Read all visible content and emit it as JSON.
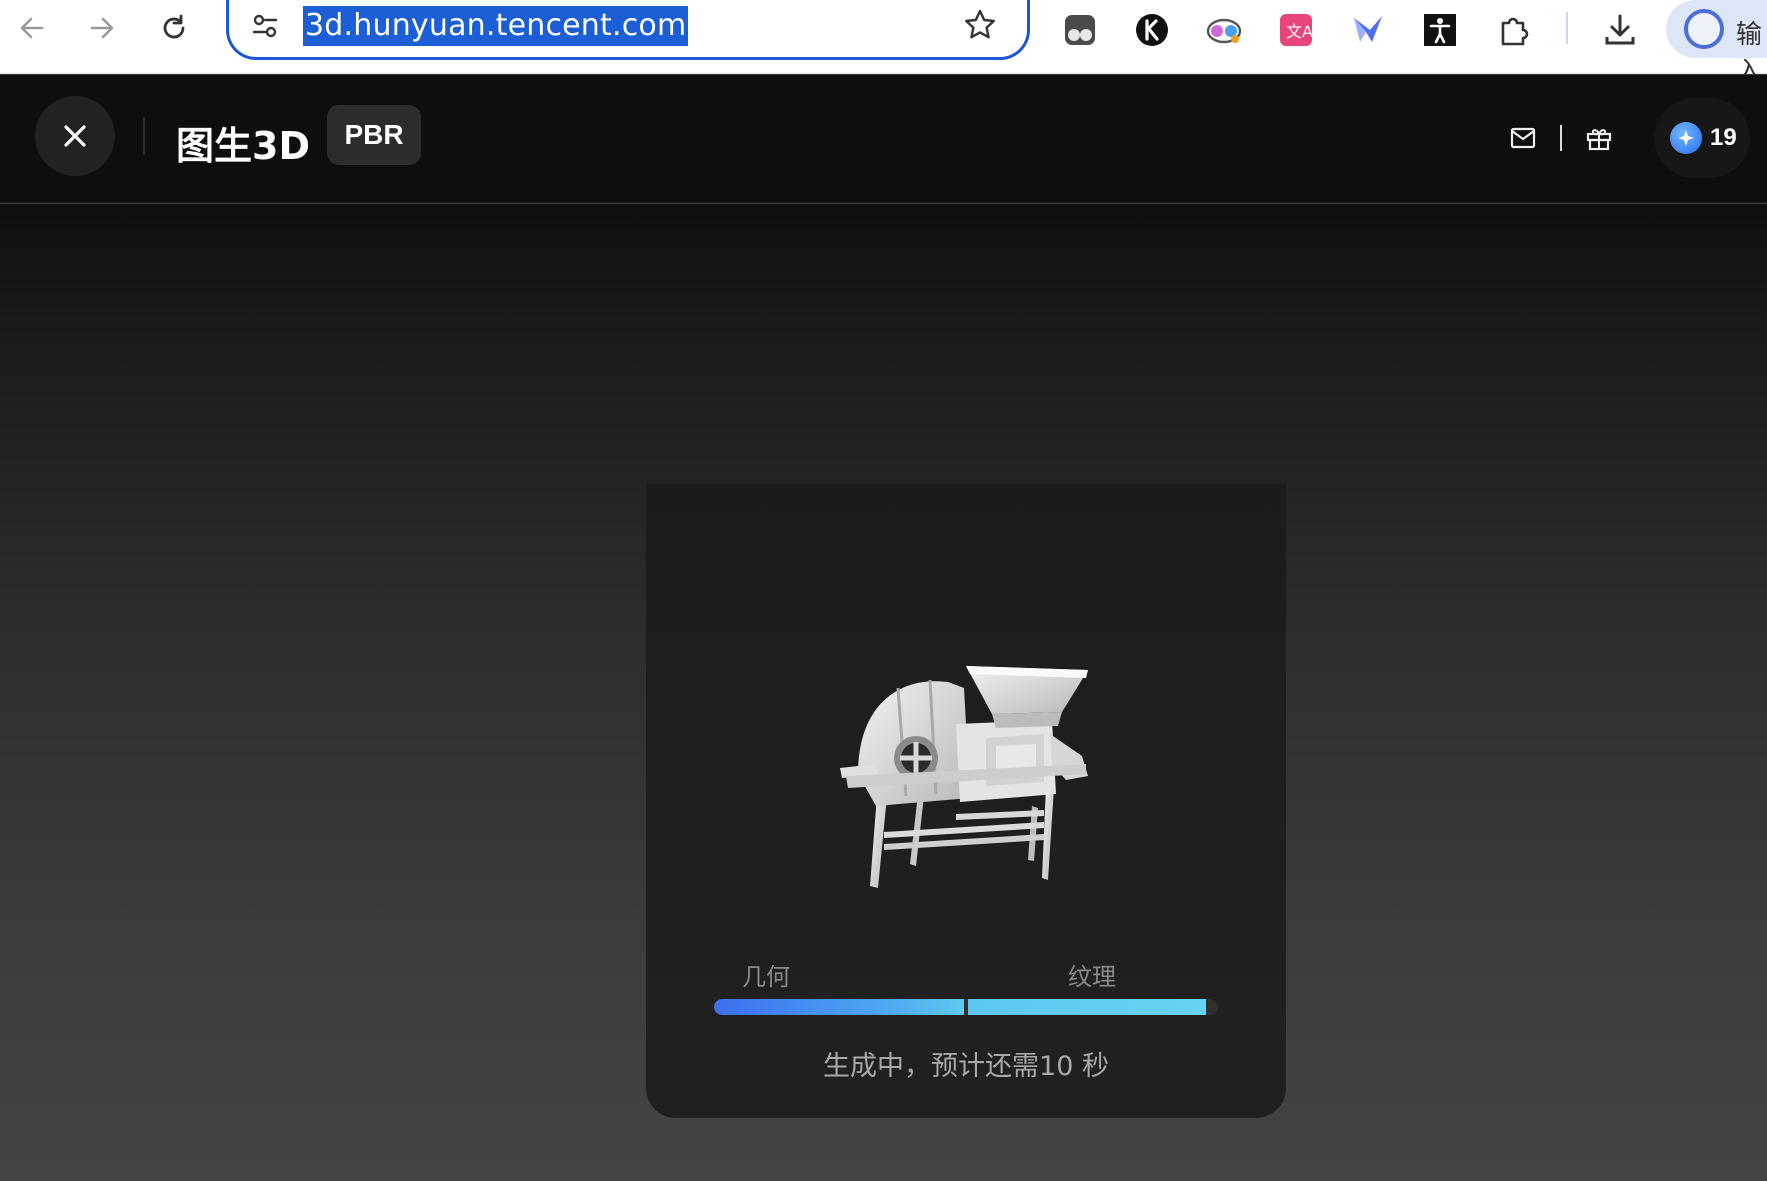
{
  "browser": {
    "url": "3d.hunyuan.tencent.com",
    "profile_label": "输入",
    "icons": {
      "back": "arrow-left-icon",
      "forward": "arrow-right-icon",
      "reload": "reload-icon",
      "site_settings": "tune-icon",
      "bookmark": "star-icon",
      "extensions": [
        "tampermonkey-icon",
        "k-extension-icon",
        "goggles-extension-icon",
        "translate-extension-icon",
        "feishu-extension-icon",
        "accessibility-extension-icon",
        "puzzle-extensions-icon"
      ],
      "downloads": "download-icon"
    }
  },
  "header": {
    "title": "图生3D",
    "badge": "PBR",
    "credits": "19",
    "icons": {
      "close": "close-icon",
      "mail": "mail-icon",
      "gift": "gift-icon",
      "credit": "sparkle-coin-icon"
    }
  },
  "generation": {
    "stages": [
      {
        "label": "几何",
        "progress": 1.0
      },
      {
        "label": "纹理",
        "progress": 0.95
      }
    ],
    "status": "生成中，预计还需10 秒",
    "colors": {
      "accent_start": "#3c6ff0",
      "accent_end": "#66d3f2",
      "track": "#2f2f2f"
    }
  }
}
